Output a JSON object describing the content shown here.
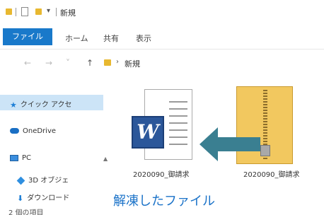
{
  "window": {
    "title": "新規",
    "quick_access_dropdown": "▾",
    "icons": [
      "folder-icon",
      "document-icon",
      "folder-icon"
    ]
  },
  "ribbon": {
    "tabs": [
      {
        "label": "ファイル",
        "active": true
      },
      {
        "label": "ホーム"
      },
      {
        "label": "共有"
      },
      {
        "label": "表示"
      }
    ]
  },
  "address_bar": {
    "back": "←",
    "forward": "→",
    "recent": "˅",
    "up": "↑",
    "separator": "›",
    "path": "新規"
  },
  "nav_pane": {
    "items": [
      {
        "label": "クイック アクセ",
        "icon": "star-icon",
        "selected": true
      },
      {
        "label": "OneDrive",
        "icon": "cloud-icon"
      },
      {
        "label": "PC",
        "icon": "pc-icon"
      },
      {
        "label": "3D オブジェ",
        "icon": "3d-objects-icon"
      },
      {
        "label": "ダウンロード",
        "icon": "download-icon"
      }
    ],
    "status": "2 個の項目"
  },
  "files": [
    {
      "name": "2020090_御請求",
      "type": "word-document",
      "icon": "word-icon",
      "badge": "W"
    },
    {
      "name": "2020090_御請求",
      "type": "zip-folder",
      "icon": "zip-folder-icon"
    }
  ],
  "annotation": {
    "text": "解凍したファイル",
    "color": "#1a72c8",
    "arrow_color": "#3a7f91"
  },
  "colors": {
    "accent": "#1979ca",
    "selection": "#cce4f7",
    "folder": "#e8b830",
    "word": "#2b579a"
  }
}
